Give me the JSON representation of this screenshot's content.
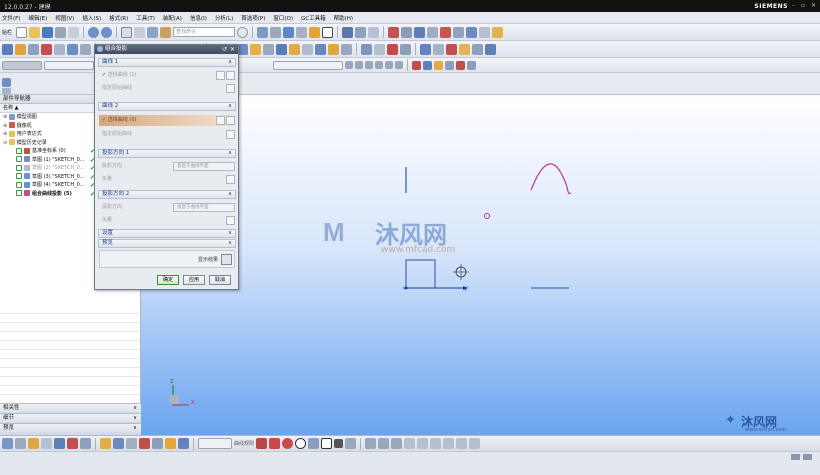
{
  "app": {
    "title": "12.0.0.27 - 建模",
    "brand": "SIEMENS"
  },
  "menu": [
    "文件(F)",
    "编辑(E)",
    "视图(V)",
    "插入(S)",
    "格式(R)",
    "工具(T)",
    "装配(A)",
    "信息(I)",
    "分析(L)",
    "首选项(P)",
    "窗口(O)",
    "GC工具箱",
    "帮助(H)"
  ],
  "toolbar": {
    "left_label": "始栏",
    "search_placeholder": "查找命令"
  },
  "navigator": {
    "title": "部件导航器",
    "col_name": "名称",
    "col_sort": "▲",
    "col_right": "最",
    "items": [
      {
        "label": "模型视图",
        "indent": 1
      },
      {
        "label": "摄像机",
        "indent": 1
      },
      {
        "label": "用户表达式",
        "indent": 1
      },
      {
        "label": "模型历史记录",
        "indent": 1
      },
      {
        "label": "基准坐标系 (0)",
        "indent": 2
      },
      {
        "label": "草图 (1) \"SKETCH_0...",
        "indent": 2
      },
      {
        "label": "草图 (2) \"SKETCH_0...",
        "indent": 2
      },
      {
        "label": "草图 (3) \"SKETCH_0...",
        "indent": 2
      },
      {
        "label": "草图 (4) \"SKETCH_0...",
        "indent": 2
      },
      {
        "label": "组合曲线投影 (5)",
        "indent": 2
      }
    ],
    "panels": [
      "相关性",
      "细节",
      "预览"
    ]
  },
  "dialog": {
    "title": "组合投影",
    "curve1": {
      "header": "曲线 1",
      "select": "选择曲线 (1)",
      "reverse": "指定原始曲线"
    },
    "curve2": {
      "header": "曲线 2",
      "select": "选择曲线 (0)",
      "reverse": "指定原始曲线"
    },
    "dir1": {
      "header": "投影方向 1",
      "label": "投影方向",
      "value": "垂直于曲线平面",
      "vector": "矢量"
    },
    "dir2": {
      "header": "投影方向 2",
      "label": "投影方向",
      "value": "垂直于曲线平面",
      "vector": "矢量"
    },
    "settings": "设置",
    "preview": "预览",
    "show_result": "显示结果",
    "ok": "确定",
    "apply": "应用",
    "cancel": "取消"
  },
  "viewport": {
    "watermark_cn": "沐风网",
    "watermark_url": "www.mfcad.com",
    "axis_label": "Y",
    "z_label": "Z",
    "x_label": "X"
  },
  "statusbar": {
    "label": "曲线规则"
  },
  "bottom": {
    "logo_cn": "沐风网",
    "logo_url": "www.mfcad.com"
  }
}
